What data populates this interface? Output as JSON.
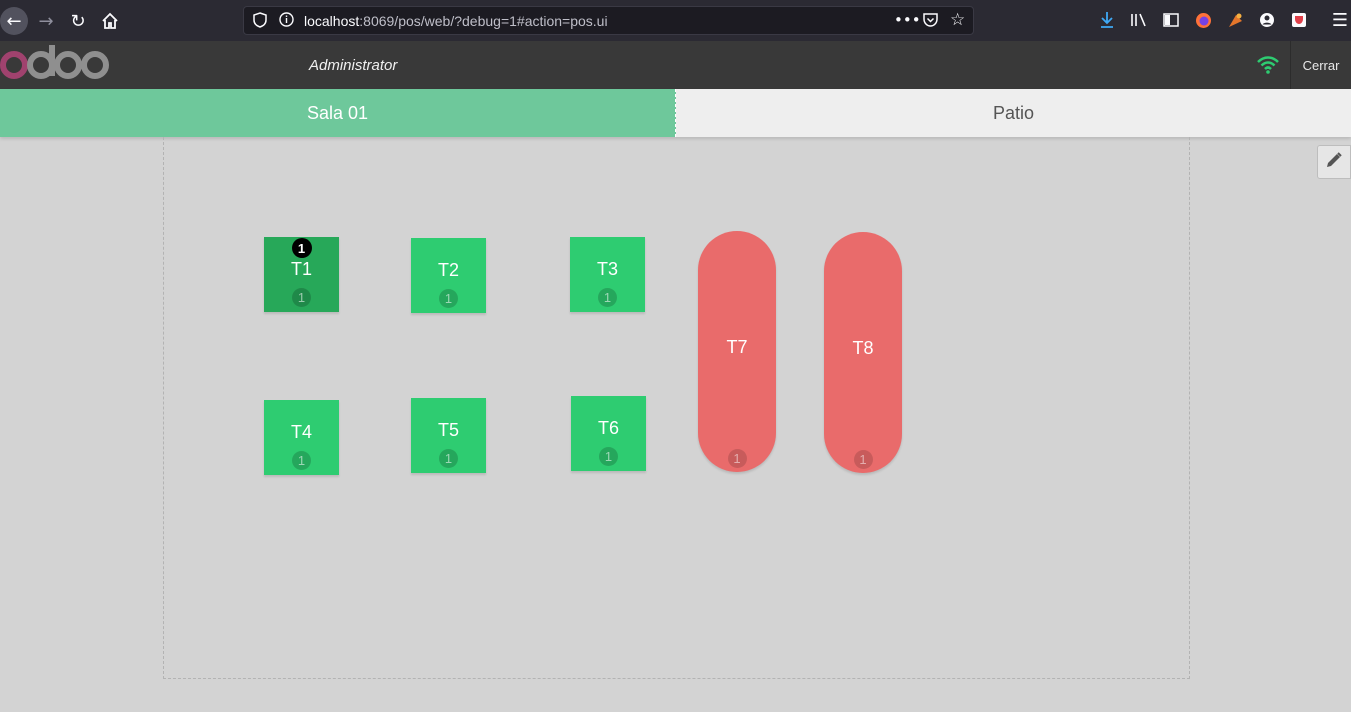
{
  "browser": {
    "url_host": "localhost",
    "url_rest": ":8069/pos/web/?debug=1#action=pos.ui",
    "icons": [
      "back-icon",
      "forward-icon",
      "reload-icon",
      "home-icon",
      "shield-icon",
      "info-icon",
      "more-icon",
      "pocket-icon",
      "star-icon",
      "download-icon",
      "library-icon",
      "sidebar-icon",
      "firefox-icon",
      "extension-icon",
      "account-icon",
      "pocket-save-icon",
      "menu-icon"
    ]
  },
  "header": {
    "cashier": "Administrator",
    "close_label": "Cerrar",
    "logo_text": "odoo"
  },
  "floors": [
    {
      "label": "Sala 01",
      "active": true
    },
    {
      "label": "Patio",
      "active": false
    }
  ],
  "tables": [
    {
      "name": "T1",
      "seats": "1",
      "orders": "1",
      "color": "#27a859",
      "shape": "square"
    },
    {
      "name": "T2",
      "seats": "1",
      "color": "#2ecc71",
      "shape": "square"
    },
    {
      "name": "T3",
      "seats": "1",
      "color": "#2ecc71",
      "shape": "square"
    },
    {
      "name": "T4",
      "seats": "1",
      "color": "#2ecc71",
      "shape": "square"
    },
    {
      "name": "T5",
      "seats": "1",
      "color": "#2ecc71",
      "shape": "square"
    },
    {
      "name": "T6",
      "seats": "1",
      "color": "#2ecc71",
      "shape": "square"
    },
    {
      "name": "T7",
      "seats": "1",
      "color": "#e96b6b",
      "shape": "round"
    },
    {
      "name": "T8",
      "seats": "1",
      "color": "#e96b6b",
      "shape": "round"
    }
  ],
  "colors": {
    "header_bg": "#393939",
    "active_floor": "#6ec89b",
    "floor_bg": "#d3d3d3",
    "wifi": "#2ecc71",
    "logo_o": "#a0426e",
    "logo_rest": "#8f8f8f"
  }
}
